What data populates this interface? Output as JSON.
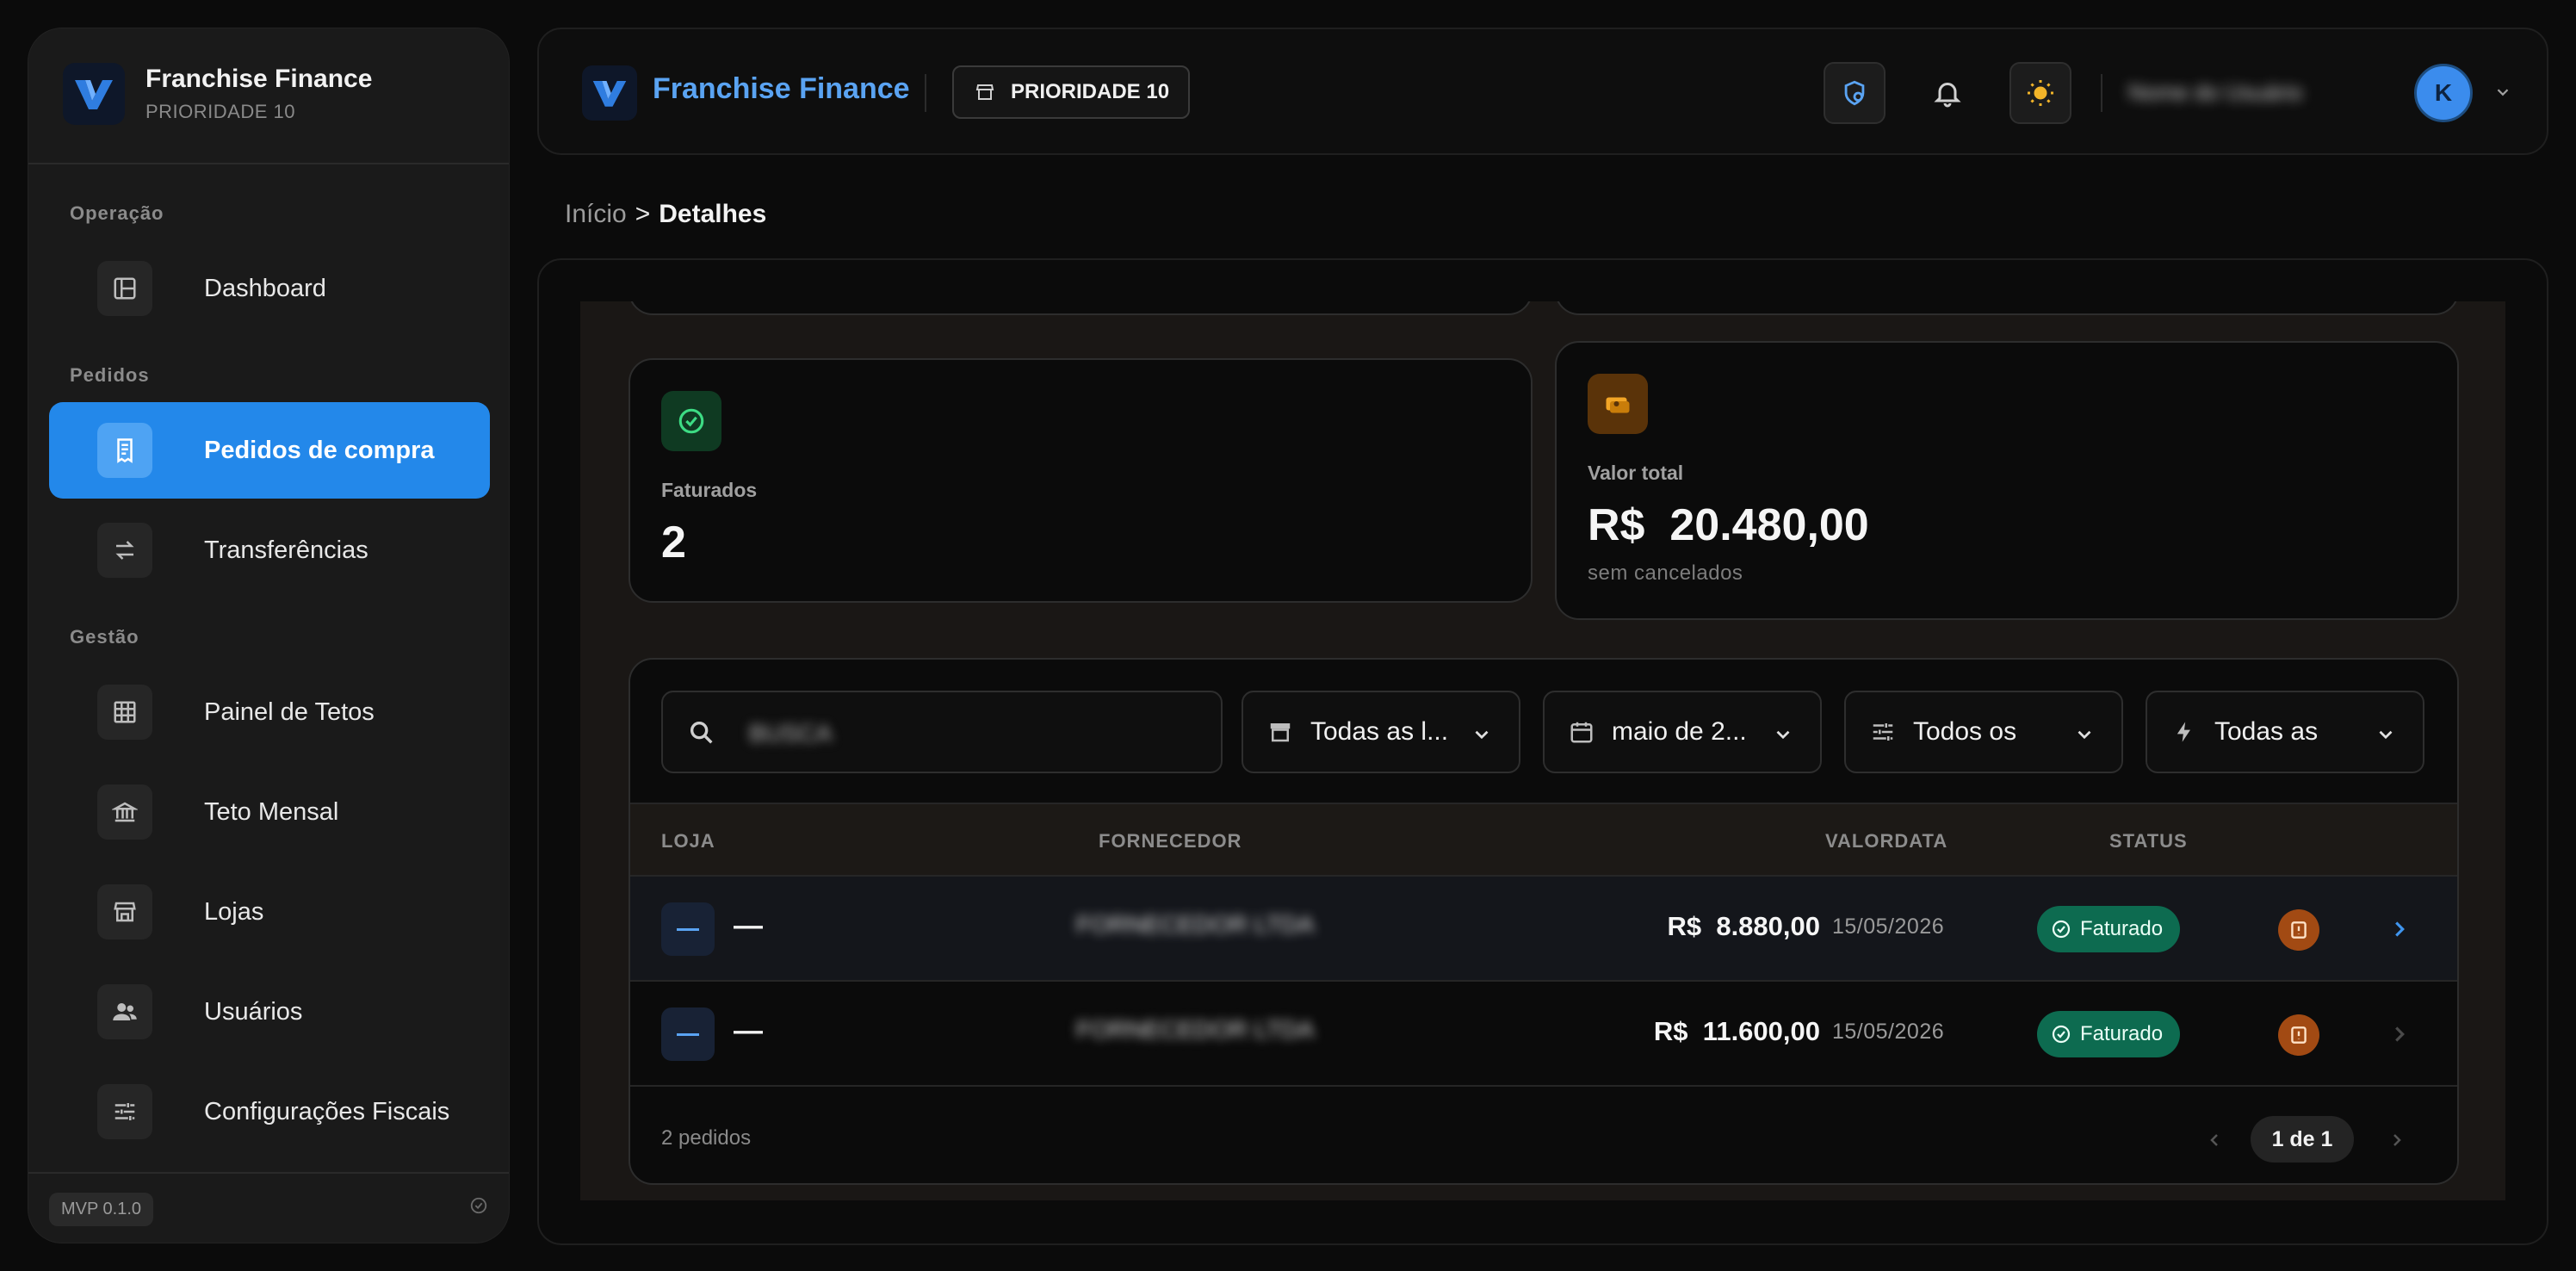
{
  "colors": {
    "accent": "#2388ea",
    "brand_text": "#5aa3f2",
    "success": "#0d6b50",
    "warning_icon_bg": "#5a3309",
    "danger_action": "#a24a13"
  },
  "sidebar": {
    "brand_title": "Franchise Finance",
    "brand_subtitle": "PRIORIDADE 10",
    "sections": {
      "operacao": "Operação",
      "pedidos": "Pedidos",
      "gestao": "Gestão"
    },
    "items": [
      {
        "label": "Dashboard",
        "icon": "dashboard-icon"
      },
      {
        "label": "Pedidos de compra",
        "icon": "receipt-icon",
        "active": true
      },
      {
        "label": "Transferências",
        "icon": "transfer-icon"
      },
      {
        "label": "Painel de Tetos",
        "icon": "grid-icon"
      },
      {
        "label": "Teto Mensal",
        "icon": "bank-icon"
      },
      {
        "label": "Lojas",
        "icon": "store-icon"
      },
      {
        "label": "Usuários",
        "icon": "users-icon"
      },
      {
        "label": "Configurações Fiscais",
        "icon": "sliders-icon"
      }
    ],
    "version": "MVP 0.1.0"
  },
  "header": {
    "title": "Franchise Finance",
    "badge": "PRIORIDADE 10",
    "user_name": "Nome do Usuário",
    "avatar_initial": "K"
  },
  "breadcrumb": {
    "home": "Início",
    "separator": ">",
    "current": "Detalhes"
  },
  "stats": {
    "faturados": {
      "label": "Faturados",
      "value": "2"
    },
    "valor_total": {
      "label": "Valor total",
      "currency": "R$",
      "value": "20.480,00",
      "sub": "sem cancelados"
    }
  },
  "filters": {
    "search_value": "BUSCA",
    "loja": "Todas as l...",
    "periodo": "maio de 2...",
    "tipo": "Todos os",
    "prioridade": "Todas as"
  },
  "table": {
    "columns": {
      "loja": "LOJA",
      "fornecedor": "FORNECEDOR",
      "valor_data": "VALORDATA",
      "status": "STATUS"
    },
    "rows": [
      {
        "loja": "—",
        "fornecedor": "FORNECEDOR LTDA",
        "currency": "R$",
        "valor": "8.880,00",
        "data": "15/05/2026",
        "status": "Faturado"
      },
      {
        "loja": "—",
        "fornecedor": "FORNECEDOR LTDA",
        "currency": "R$",
        "valor": "11.600,00",
        "data": "15/05/2026",
        "status": "Faturado"
      }
    ],
    "footer_count": "2 pedidos",
    "pagination": "1 de 1"
  }
}
